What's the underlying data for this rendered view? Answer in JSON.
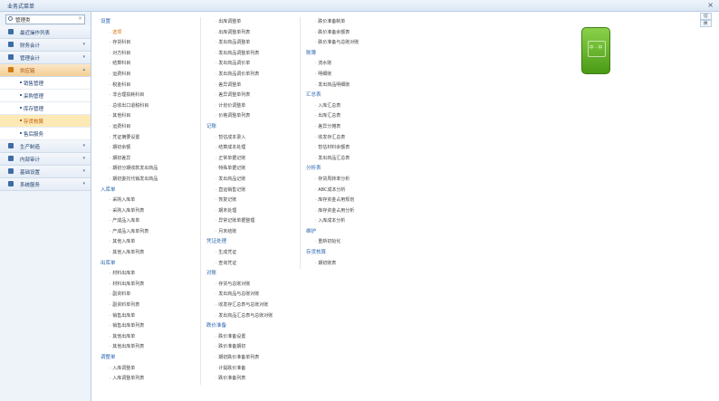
{
  "window": {
    "title": "业务式菜单",
    "close": "×"
  },
  "search": {
    "value": "管理类",
    "clear": "×"
  },
  "sidebar": [
    {
      "label": "最近操作列表",
      "icon": "history-icon",
      "type": "top"
    },
    {
      "label": "财务会计",
      "icon": "finance-icon",
      "type": "top",
      "arrow": "▾"
    },
    {
      "label": "管理会计",
      "icon": "chart-icon",
      "type": "top",
      "arrow": "▾"
    },
    {
      "label": "供应链",
      "icon": "supply-icon",
      "type": "top",
      "arrow": "▴",
      "active": true
    },
    {
      "label": "销售管理",
      "type": "sub"
    },
    {
      "label": "采购管理",
      "type": "sub"
    },
    {
      "label": "库存管理",
      "type": "sub"
    },
    {
      "label": "存货核算",
      "type": "sub",
      "active": true
    },
    {
      "label": "售后服务",
      "type": "sub"
    },
    {
      "label": "生产制造",
      "icon": "factory-icon",
      "type": "top",
      "arrow": "▾"
    },
    {
      "label": "内部审计",
      "icon": "audit-icon",
      "type": "top",
      "arrow": "▾"
    },
    {
      "label": "基础设置",
      "icon": "settings-icon",
      "type": "top",
      "arrow": "▾"
    },
    {
      "label": "系统服务",
      "icon": "system-icon",
      "type": "top",
      "arrow": "▾"
    }
  ],
  "columns": [
    [
      {
        "g": "设置"
      },
      {
        "i": "选项",
        "sel": true
      },
      {
        "i": "存货科目"
      },
      {
        "i": "对方科目"
      },
      {
        "i": "结算科目"
      },
      {
        "i": "运费科目"
      },
      {
        "i": "税金科目"
      },
      {
        "i": "非合理损耗科目"
      },
      {
        "i": "总收出口退税科目"
      },
      {
        "i": "其他科目"
      },
      {
        "i": "运费科目"
      },
      {
        "i": "凭证摘要设置"
      },
      {
        "i": "期初余额"
      },
      {
        "i": "期初差异"
      },
      {
        "i": "期初分期收款发出商品"
      },
      {
        "i": "期初委托代销发出商品"
      },
      {
        "g": "入库单"
      },
      {
        "i": "采购入库单"
      },
      {
        "i": "采购入库单列表"
      },
      {
        "i": "产成品入库单"
      },
      {
        "i": "产成品入库单列表"
      },
      {
        "i": "其他入库单"
      },
      {
        "i": "其他入库单列表"
      },
      {
        "g": "出库单"
      },
      {
        "i": "材料出库单"
      },
      {
        "i": "材料出库单列表"
      },
      {
        "i": "副资料单"
      },
      {
        "i": "副资料单列表"
      },
      {
        "i": "销售出库单"
      },
      {
        "i": "销售出库单列表"
      },
      {
        "i": "其他出库单"
      },
      {
        "i": "其他出库单列表"
      },
      {
        "g": "调整单"
      },
      {
        "i": "入库调整单"
      },
      {
        "i": "入库调整单列表"
      }
    ],
    [
      {
        "i": "出库调整单"
      },
      {
        "i": "出库调整单列表"
      },
      {
        "i": "发出商品调整单"
      },
      {
        "i": "发出商品调整单列表"
      },
      {
        "i": "发出商品调价单"
      },
      {
        "i": "发出商品调价单列表"
      },
      {
        "i": "差异调整单"
      },
      {
        "i": "差异调整单列表"
      },
      {
        "i": "计划价调整单"
      },
      {
        "i": "价格调整单列表"
      },
      {
        "g": "记账"
      },
      {
        "i": "暂估成本录入"
      },
      {
        "i": "结算成本处理"
      },
      {
        "i": "正常单据记账"
      },
      {
        "i": "特殊单据记账"
      },
      {
        "i": "发出商品记账"
      },
      {
        "i": "直运销售记账"
      },
      {
        "i": "恢复记账"
      },
      {
        "i": "期末处理"
      },
      {
        "i": "异常记账单据整理"
      },
      {
        "i": "月末结账"
      },
      {
        "g": "凭证处理"
      },
      {
        "i": "生成凭证"
      },
      {
        "i": "查询凭证"
      },
      {
        "g": "对账"
      },
      {
        "i": "存货与总账对账"
      },
      {
        "i": "发出商品与总账对账"
      },
      {
        "i": "收发存汇总表与总账对账"
      },
      {
        "i": "发出商品汇总表与总账对账"
      },
      {
        "g": "跌价准备"
      },
      {
        "i": "跌价准备设置"
      },
      {
        "i": "跌价准备期初"
      },
      {
        "i": "期初跌价准备单列表"
      },
      {
        "i": "计提跌价准备"
      },
      {
        "i": "跌价准备列表"
      }
    ],
    [
      {
        "i": "跌价准备制单"
      },
      {
        "i": "跌价准备余额表"
      },
      {
        "i": "跌价准备与总账对账"
      },
      {
        "g": "账簿"
      },
      {
        "i": "流水账"
      },
      {
        "i": "明细账"
      },
      {
        "i": "发出商品明细账"
      },
      {
        "g": "汇总表"
      },
      {
        "i": "入库汇总表"
      },
      {
        "i": "出库汇总表"
      },
      {
        "i": "差异分摊表"
      },
      {
        "i": "收发存汇总表"
      },
      {
        "i": "暂估材料余额表"
      },
      {
        "i": "发出商品汇总表"
      },
      {
        "g": "分析表"
      },
      {
        "i": "存货周转率分析"
      },
      {
        "i": "ABC成本分析"
      },
      {
        "i": "库存资金占用规划"
      },
      {
        "i": "库存资金占用分析"
      },
      {
        "i": "入库成本分析"
      },
      {
        "g": "维护"
      },
      {
        "i": "重新初始化"
      },
      {
        "g": "存货核算"
      },
      {
        "i": "期初账表"
      }
    ]
  ],
  "tabs": [
    "切",
    "换"
  ],
  "badge": {
    "text": "中 · 中"
  }
}
